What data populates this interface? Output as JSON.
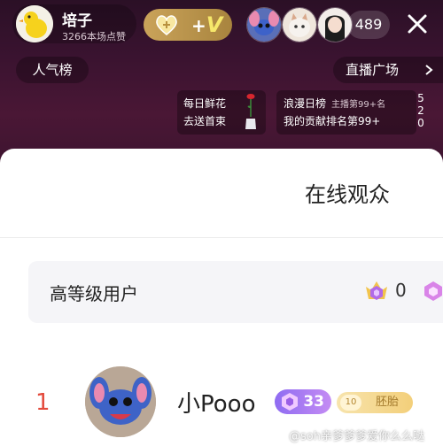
{
  "host": {
    "name": "培子",
    "likes": "3266本场点赞"
  },
  "badge": {
    "plus_text": "+",
    "v_text": "V"
  },
  "viewers": {
    "count": "489"
  },
  "nav": {
    "rank_tab": "人气榜",
    "plaza_button": "直播广场"
  },
  "flower_card": {
    "line1": "每日鲜花",
    "line2": "去送首束"
  },
  "daily_card": {
    "title": "浪漫日榜",
    "subtitle": "主播第99+名",
    "line2": "我的贡献排名第99+"
  },
  "side_text": {
    "d1": "5",
    "d2": "2",
    "d3": "0"
  },
  "panel": {
    "title": "在线观众"
  },
  "level_section": {
    "title": "高等级用户",
    "count": "0"
  },
  "audience_list": [
    {
      "rank": "1",
      "name": "小Pooo",
      "level": "33",
      "fan_level": "10",
      "fan_title": "胚胎"
    }
  ],
  "watermark": "@soh亲爹爹爹爱你么么哒",
  "colors": {
    "header_bg": "#3a1330",
    "rank_red": "#e34a3c",
    "level_purple": "#8f6cf2",
    "fan_gold": "#f3cf7a"
  }
}
